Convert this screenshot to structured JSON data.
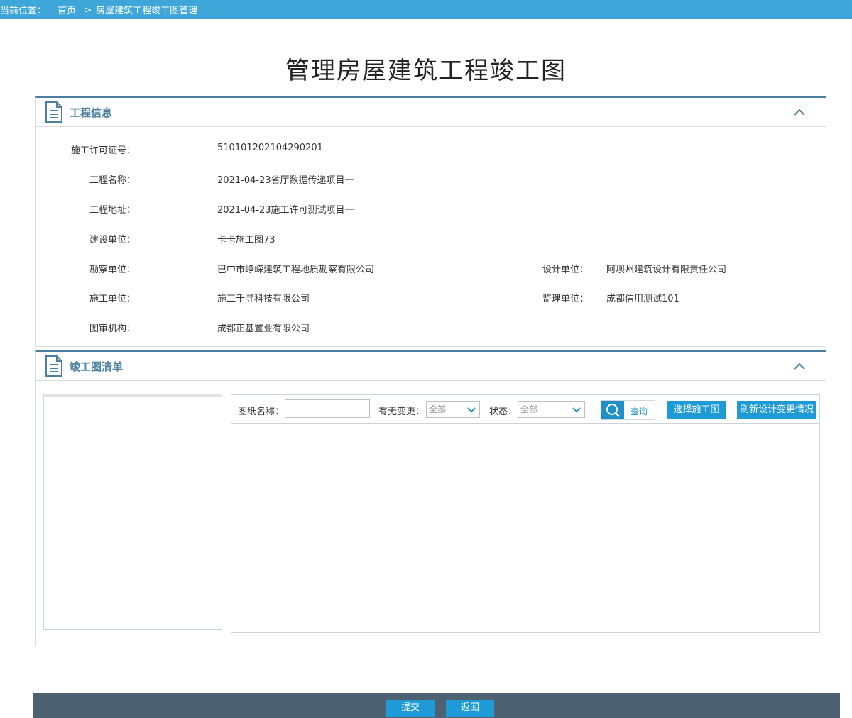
{
  "breadcrumb": {
    "label": "当前位置：",
    "home": "首页",
    "separator": ">",
    "current": "房屋建筑工程竣工图管理"
  },
  "page_title": "管理房屋建筑工程竣工图",
  "project_panel": {
    "title": "工程信息",
    "fields": {
      "permit_no_label": "施工许可证号：",
      "permit_no": "510101202104290201",
      "project_name_label": "工程名称：",
      "project_name": "2021-04-23省厅数据传递项目一",
      "project_address_label": "工程地址：",
      "project_address": "2021-04-23施工许可测试项目一",
      "builder_label": "建设单位：",
      "builder": "卡卡施工图73",
      "survey_label": "勘察单位：",
      "survey": "巴中市峥嵘建筑工程地质勘察有限公司",
      "design_label": "设计单位：",
      "design": "阿坝州建筑设计有限责任公司",
      "construction_label": "施工单位：",
      "construction": "施工千寻科技有限公司",
      "supervision_label": "监理单位：",
      "supervision": "成都信用测试101",
      "review_label": "图审机构：",
      "review": "成都正基置业有限公司"
    }
  },
  "list_panel": {
    "title": "竣工图清单",
    "toolbar": {
      "name_label": "图纸名称：",
      "name_value": "",
      "change_label": "有无变更：",
      "change_selected": "全部",
      "status_label": "状态：",
      "status_selected": "全部",
      "query_label": "查询",
      "select_drawing_label": "选择施工图",
      "refresh_label": "刷新设计变更情况"
    }
  },
  "footer": {
    "submit_label": "提交",
    "back_label": "返回"
  },
  "colors": {
    "topbar": "#3ea6d9",
    "panel_accent": "#4a7fa1",
    "button": "#1e9ad6",
    "footer": "#4d6270"
  },
  "icons": [
    "document-icon",
    "chevron-up-icon",
    "chevron-down-icon",
    "search-icon"
  ]
}
